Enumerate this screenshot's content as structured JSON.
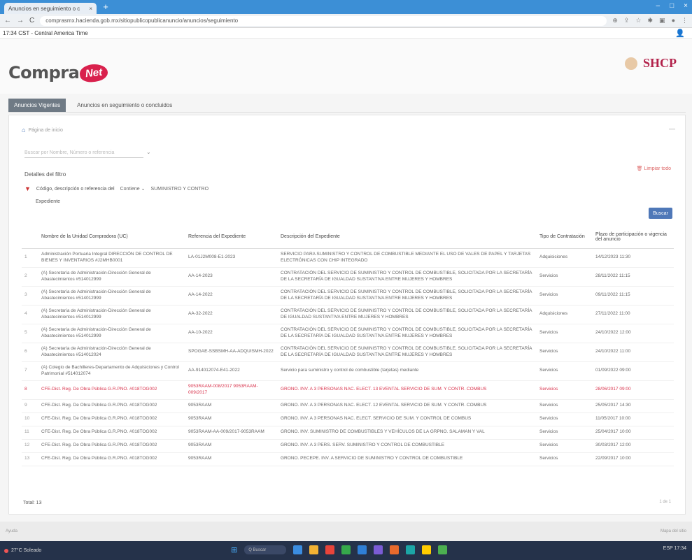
{
  "browser": {
    "tab_title": "Anuncios en seguimiento o c",
    "tab_close": "×",
    "new_tab": "+",
    "url": "comprasmx.hacienda.gob.mx/sitiopublicopublicanuncio/anuncios/seguimiento",
    "window_controls": [
      "–",
      "□",
      "×"
    ],
    "nav": {
      "back": "←",
      "forward": "→",
      "reload": "C"
    }
  },
  "infobar": {
    "clock": "17:34 CST - Central America Time"
  },
  "header": {
    "logo_main": "Compra",
    "logo_badge": "Net",
    "agency": "SHCP"
  },
  "tabs": [
    {
      "label": "Anuncios Vigentes",
      "active": true
    },
    {
      "label": "Anuncios en seguimiento o concluidos",
      "active": false
    }
  ],
  "card": {
    "breadcrumb": "Página de inicio",
    "search_placeholder": "Buscar por Nombre, Número o referencia",
    "details_title": "Detalles del filtro",
    "clear_link": "Limpiar todo",
    "filter_label": "Código, descripción o referencia del",
    "filter_operator": "Contiene",
    "filter_value": "SUMINISTRO Y CONTRO",
    "filter_label_cont": "Expediente",
    "search_button": "Buscar"
  },
  "table": {
    "headers": [
      "",
      "Nombre de la Unidad Compradora (UC)",
      "Referencia del Expediente",
      "Descripción del Expediente",
      "Tipo de Contratación",
      "Plazo de participación o vigencia del anuncio"
    ],
    "rows": [
      {
        "n": "1",
        "uc": "Administración Portuaria Integral DIRECCIÓN DE CONTROL DE BIENES Y INVENTARIOS #J2MHB0001",
        "ref": "LA-01J2M008-E1-2023",
        "desc": "SERVICIO PARA SUMINISTRO Y CONTROL DE COMBUSTIBLE MEDIANTE EL USO DE VALES DE PAPEL Y TARJETAS ELECTRÓNICAS CON CHIP INTEGRADO",
        "tipo": "Adquisiciones",
        "plazo": "14/12/2023 11:30",
        "cls": ""
      },
      {
        "n": "2",
        "uc": "(A) Secretaría de Administración-Dirección General de Abastecimientos #514012999",
        "ref": "AA-14-2023",
        "desc": "CONTRATACIÓN DEL SERVICIO DE SUMINISTRO Y CONTROL DE COMBUSTIBLE, SOLICITADA POR LA SECRETARÍA DE LA SECRETARÍA DE IGUALDAD SUSTANTIVA ENTRE MUJERES Y HOMBRES",
        "tipo": "Servicios",
        "plazo": "28/11/2022 11:15",
        "cls": ""
      },
      {
        "n": "3",
        "uc": "(A) Secretaría de Administración-Dirección General de Abastecimientos #514012999",
        "ref": "AA-14-2022",
        "desc": "CONTRATACIÓN DEL SERVICIO DE SUMINISTRO Y CONTROL DE COMBUSTIBLE, SOLICITADA POR LA SECRETARÍA DE LA SECRETARÍA DE IGUALDAD SUSTANTIVA ENTRE MUJERES Y HOMBRES",
        "tipo": "Servicios",
        "plazo": "09/11/2022 11:15",
        "cls": ""
      },
      {
        "n": "4",
        "uc": "(A) Secretaría de Administración-Dirección General de Abastecimientos #514012999",
        "ref": "AA-32-2022",
        "desc": "CONTRATACIÓN DEL SERVICIO DE SUMINISTRO Y CONTROL DE COMBUSTIBLE, SOLICITADA POR LA SECRETARÍA DE IGUALDAD SUSTANTIVA ENTRE MUJERES Y HOMBRES",
        "tipo": "Adquisiciones",
        "plazo": "27/11/2022 11:00",
        "cls": ""
      },
      {
        "n": "5",
        "uc": "(A) Secretaría de Administración-Dirección General de Abastecimientos #514012999",
        "ref": "AA-10-2022",
        "desc": "CONTRATACIÓN DEL SERVICIO DE SUMINISTRO Y CONTROL DE COMBUSTIBLE, SOLICITADA POR LA SECRETARÍA DE LA SECRETARÍA DE IGUALDAD SUSTANTIVA ENTRE MUJERES Y HOMBRES",
        "tipo": "Servicios",
        "plazo": "24/10/2022 12:00",
        "cls": ""
      },
      {
        "n": "6",
        "uc": "(A) Secretaría de Administración-Dirección General de Abastecimientos #514012024",
        "ref": "SPOGAE-SSBSMH-AA-ADQUISMH-2022",
        "desc": "CONTRATACIÓN DEL SERVICIO DE SUMINISTRO Y CONTROL DE COMBUSTIBLE, SOLICITADA POR LA SECRETARÍA DE LA SECRETARÍA DE IGUALDAD SUSTANTIVA ENTRE MUJERES Y HOMBRES",
        "tipo": "Servicios",
        "plazo": "24/10/2022 11:00",
        "cls": ""
      },
      {
        "n": "7",
        "uc": "(A) Colegio de Bachilleres-Departamento de Adquisiciones y Control Patrimonial #514012074",
        "ref": "AA-914012074-E41-2022",
        "desc": "Servicio para suministro y control de combustible (tarjetas) mediante",
        "tipo": "Servicios",
        "plazo": "01/09/2022 09:00",
        "cls": ""
      },
      {
        "n": "8",
        "uc": "CFE-Dist. Reg. De Obra Pública G.R.PNO. #018TOG002",
        "ref": "9053RAAM-008/2017 9053RAAM-009/2017",
        "desc": "GRONO. INV. A 3 PERSONAS NAC. ELECT. 13 EVENTAL SERVICIO DE SUM. Y CONTR. COMBUS",
        "tipo": "Servicios",
        "plazo": "28/06/2017 09:00",
        "cls": "highlight"
      },
      {
        "n": "9",
        "uc": "CFE-Dist. Reg. De Obra Pública G.R.PNO. #018TOG002",
        "ref": "9053RAAM",
        "desc": "GRONO. INV. A 3 PERSONAS NAC. ELECT. 12 EVENTAL SERVICIO DE SUM. Y CONTR. COMBUS",
        "tipo": "Servicios",
        "plazo": "25/05/2017 14:30",
        "cls": "compact"
      },
      {
        "n": "10",
        "uc": "CFE-Dist. Reg. De Obra Pública G.R.PNO. #018TOG002",
        "ref": "9053RAAM",
        "desc": "GRONO. INV. A 3 PERSONAS NAC. ELECT. SERVICIO DE SUM. Y CONTROL DE COMBUS",
        "tipo": "Servicios",
        "plazo": "11/05/2017 10:00",
        "cls": "compact"
      },
      {
        "n": "11",
        "uc": "CFE-Dist. Reg. De Obra Pública G.R.PNO. #018TOG002",
        "ref": "9053RAAM-AA-009/2017-9053RAAM",
        "desc": "GRONO. INV. SUMINISTRO DE COMBUSTIBLES Y VEHÍCULOS DE LA GRPNO. SALAMAN Y VAL",
        "tipo": "Servicios",
        "plazo": "25/04/2017 10:00",
        "cls": "compact"
      },
      {
        "n": "12",
        "uc": "CFE-Dist. Reg. De Obra Pública G.R.PNO. #018TOG002",
        "ref": "9053RAAM",
        "desc": "GRONO. INV. A 3 PERS. SERV. SUMINISTRO Y CONTROL DE COMBUSTIBLE",
        "tipo": "Servicios",
        "plazo": "30/03/2017 12:00",
        "cls": "compact"
      },
      {
        "n": "13",
        "uc": "CFE-Dist. Reg. De Obra Pública G.R.PNO. #018TOG002",
        "ref": "9053RAAM",
        "desc": "GRONO. PECEPE. INV. A SERVICIO DE SUMINISTRO Y CONTROL DE COMBUSTIBLE",
        "tipo": "Servicios",
        "plazo": "22/09/2017 10:00",
        "cls": "compact"
      }
    ],
    "total": "Total: 13",
    "pager": "1 de 1"
  },
  "bottomstrip": {
    "left": "Ayuda",
    "right": "Mapa del sitio"
  },
  "taskbar": {
    "weather": "27°C Soleado",
    "search": "Q Buscar",
    "tray": "ESP  17:34"
  },
  "colors": {
    "taskbar_icons": [
      "#3b8de0",
      "#f2b233",
      "#e8443a",
      "#36a94b",
      "#2f7fd6",
      "#7b5cd6",
      "#e86a2c",
      "#1ca6a6",
      "#ffcc00",
      "#4caf50"
    ]
  }
}
